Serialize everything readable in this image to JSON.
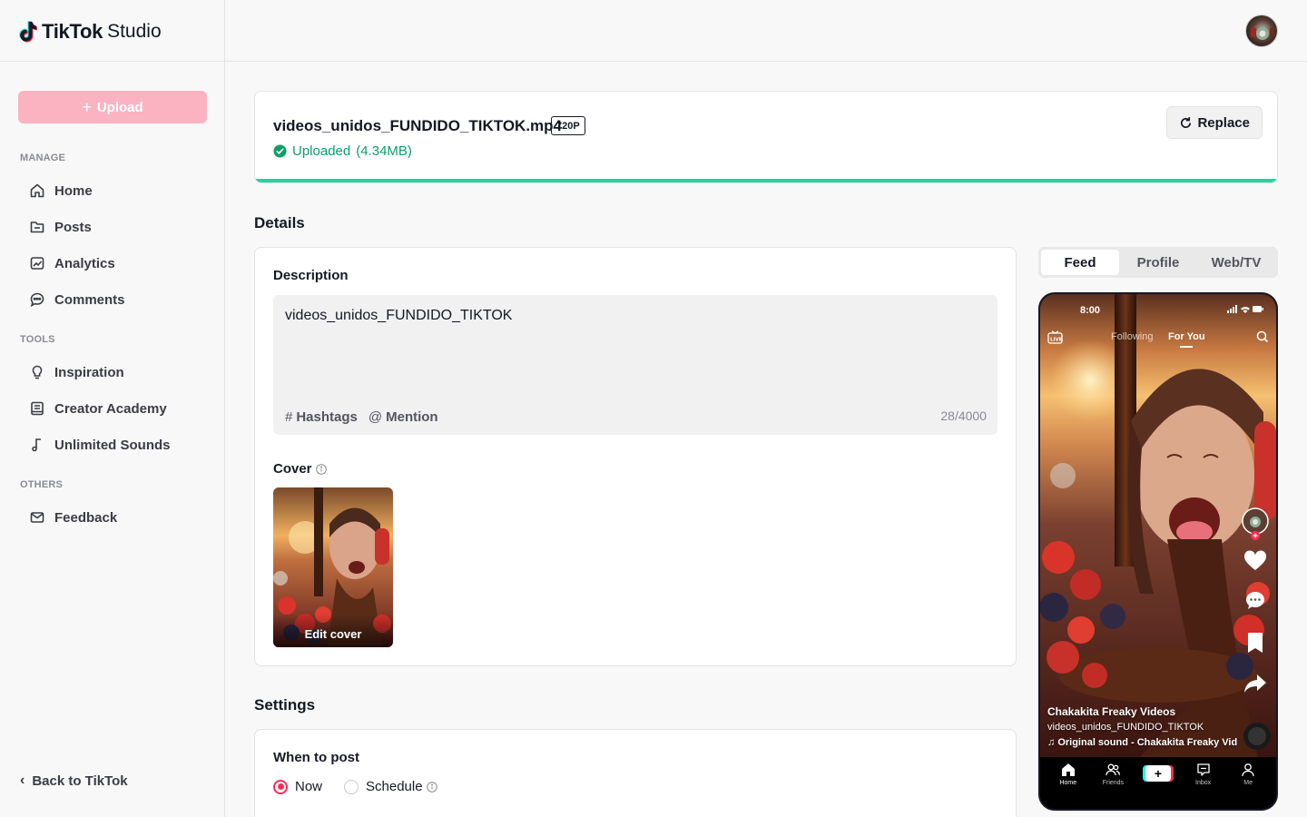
{
  "brand": {
    "name": "TikTok",
    "product": "Studio"
  },
  "sidebar": {
    "upload_label": "Upload",
    "sections": {
      "manage": "MANAGE",
      "tools": "TOOLS",
      "others": "OTHERS"
    },
    "items": [
      {
        "label": "Home",
        "icon": "home-icon"
      },
      {
        "label": "Posts",
        "icon": "folder-icon"
      },
      {
        "label": "Analytics",
        "icon": "analytics-icon"
      },
      {
        "label": "Comments",
        "icon": "comment-icon"
      },
      {
        "label": "Inspiration",
        "icon": "lightbulb-icon"
      },
      {
        "label": "Creator Academy",
        "icon": "book-icon"
      },
      {
        "label": "Unlimited Sounds",
        "icon": "music-note-icon"
      },
      {
        "label": "Feedback",
        "icon": "mail-icon"
      }
    ],
    "back_label": "Back to TikTok"
  },
  "file": {
    "name": "videos_unidos_FUNDIDO_TIKTOK.mp4",
    "quality": "720P",
    "status": "Uploaded",
    "size": "(4.34MB)",
    "replace_label": "Replace",
    "progress": 1.0
  },
  "details": {
    "title": "Details",
    "description_label": "Description",
    "description_value": "videos_unidos_FUNDIDO_TIKTOK",
    "hashtags_label": "Hashtags",
    "mention_label": "Mention",
    "char_count": "28/4000",
    "cover_label": "Cover",
    "edit_cover_label": "Edit cover"
  },
  "settings": {
    "title": "Settings",
    "when_label": "When to post",
    "options": [
      "Now",
      "Schedule"
    ],
    "selected": "Now"
  },
  "preview": {
    "tabs": [
      "Feed",
      "Profile",
      "Web/TV"
    ],
    "active_tab": "Feed",
    "status_time": "8:00",
    "feed_following": "Following",
    "feed_foryou": "For You",
    "author": "Chakakita Freaky Videos",
    "caption": "videos_unidos_FUNDIDO_TIKTOK",
    "sound": "Original sound - Chakakita Freaky Vid",
    "nav": [
      "Home",
      "Friends",
      "Inbox",
      "Me"
    ]
  },
  "colors": {
    "accent": "#fe2c55",
    "upload_button": "#fbb3c2",
    "success": "#0a9f6a",
    "progress": "#20d5a0"
  }
}
